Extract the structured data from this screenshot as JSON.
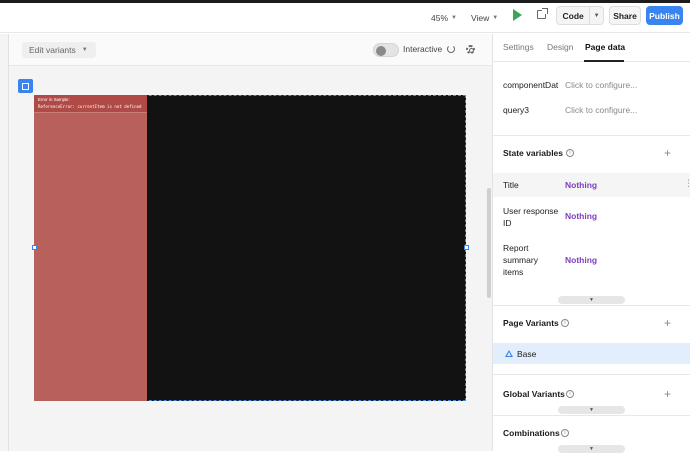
{
  "topbar": {
    "zoom": "45%",
    "view_label": "View",
    "code_label": "Code",
    "share_label": "Share",
    "publish_label": "Publish"
  },
  "canvas": {
    "variants_label": "Edit variants",
    "interactive_label": "Interactive",
    "error_title": "Error in Sample:",
    "error_message": "ReferenceError: currentItem is not defined"
  },
  "panel": {
    "tabs": [
      {
        "label": "Settings",
        "active": false
      },
      {
        "label": "Design",
        "active": false
      },
      {
        "label": "Page data",
        "active": true
      }
    ],
    "queries": [
      {
        "name": "componentDat",
        "value": "Click to configure..."
      },
      {
        "name": "query3",
        "value": "Click to configure..."
      }
    ],
    "state_variables_title": "State variables",
    "state_variables": [
      {
        "name": "Title",
        "value": "Nothing"
      },
      {
        "name": "User response ID",
        "value": "Nothing"
      },
      {
        "name": "Report summary items",
        "value": "Nothing"
      }
    ],
    "page_variants_title": "Page Variants",
    "base_label": "Base",
    "global_variants_title": "Global Variants",
    "combinations_title": "Combinations"
  },
  "colors": {
    "accent": "#3a84f0",
    "error_panel": "#b8615c",
    "artboard": "#121212",
    "nothing_value": "#7e3fc0"
  }
}
